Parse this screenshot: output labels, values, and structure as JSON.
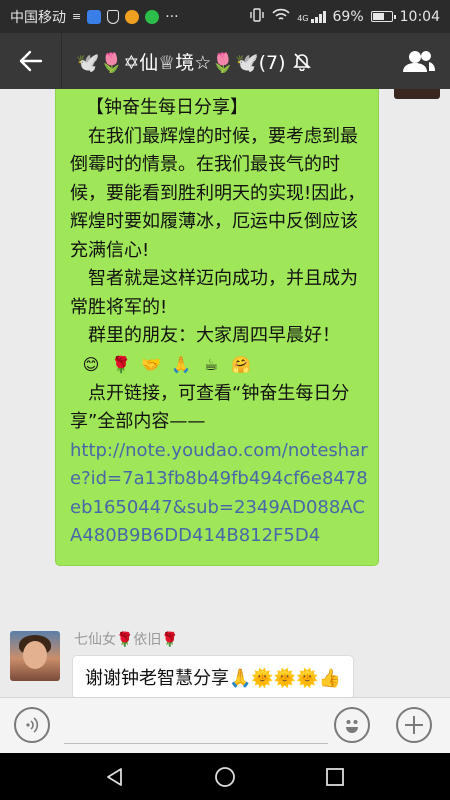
{
  "status_bar": {
    "carrier": "中国移动",
    "battery_percent": "69%",
    "battery_level": 0.69,
    "time": "10:04",
    "network": "4G",
    "more": "···"
  },
  "header": {
    "title": "🕊️🌷✡仙♕境☆🌷🕊️(7)",
    "back_icon": "back-arrow-icon",
    "mute_icon": "mute-bell-icon",
    "members_icon": "group-members-icon"
  },
  "messages": {
    "self": {
      "heading": "【钟奋生每日分享】",
      "p1": "在我们最辉煌的时候，要考虑到最倒霉时的情景。在我们最丧气的时候，要能看到胜利明天的实现!因此，辉煌时要如履薄冰，厄运中反倒应该充满信心!",
      "p2": "智者就是这样迈向成功，并且成为常胜将军的!",
      "p3": "群里的朋友：大家周四早晨好！",
      "emojis": [
        "😊",
        "🌹",
        "🤝",
        "🙏",
        "☕",
        "🤗"
      ],
      "p4": "点开链接，可查看“钟奋生每日分享”全部内容——",
      "link": "http://note.youdao.com/noteshare?id=7a13fb8b49fb494cf6e8478eb1650447&sub=2349AD088ACA480B9B6DD414B812F5D4"
    },
    "incoming": {
      "sender": "七仙女🌹依旧🌹",
      "text": "谢谢钟老智慧分享🙏🌞🌞🌞👍"
    }
  },
  "input_bar": {
    "placeholder": "",
    "voice_icon": "voice-icon",
    "emoji_icon": "emoji-icon",
    "plus_icon": "plus-icon"
  },
  "colors": {
    "self_bubble": "#9fe658",
    "title_bar": "#383838",
    "link": "#4a67a8"
  }
}
